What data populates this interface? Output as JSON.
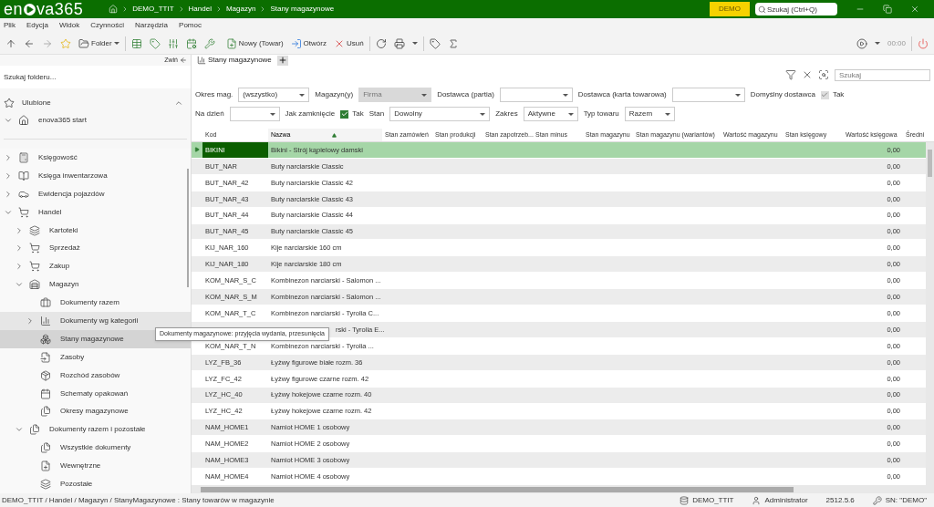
{
  "title_bar": {
    "logo_left": "en",
    "logo_right": "va365",
    "breadcrumb": [
      "DEMO_TTIT",
      "Handel",
      "Magazyn",
      "Stany magazynowe"
    ],
    "badge": "DEMO",
    "search": {
      "placeholder": "Szukaj (Ctrl+Q)"
    }
  },
  "menu": [
    "Plik",
    "Edycja",
    "Widok",
    "Czynności",
    "Narzędzia",
    "Pomoc"
  ],
  "toolbar": {
    "folder": "Folder",
    "new": "Nowy (Towar)",
    "open": "Otwórz",
    "delete": "Usuń",
    "timer": "00:00"
  },
  "sidebar": {
    "collapse": "Zwiń",
    "search": {
      "placeholder": "Szukaj folderu..."
    },
    "favorites": "Ulubione",
    "start": {
      "label": "enova365 start",
      "expanded": true
    },
    "items": [
      {
        "label": "Księgowość",
        "expanded": false,
        "selected": false
      },
      {
        "label": "Księga inwentarzowa",
        "expanded": false,
        "selected": false
      },
      {
        "label": "Ewidencja pojazdów",
        "expanded": false,
        "selected": false
      },
      {
        "label": "Handel",
        "expanded": true,
        "selected": false,
        "children": [
          {
            "label": "Kartoteki",
            "expanded": false,
            "selected": false
          },
          {
            "label": "Sprzedaż",
            "expanded": false,
            "selected": false
          },
          {
            "label": "Zakup",
            "expanded": false,
            "selected": false
          },
          {
            "label": "Magazyn",
            "expanded": true,
            "selected": false,
            "children": [
              {
                "label": "Dokumenty razem",
                "selected": false
              },
              {
                "label": "Dokumenty wg kategorii",
                "expanded": false,
                "selected": false,
                "hovered": true
              },
              {
                "label": "Stany magazynowe",
                "selected": true
              },
              {
                "label": "Zasoby",
                "selected": false
              },
              {
                "label": "Rozchód zasobów",
                "selected": false
              },
              {
                "label": "Schematy opakowań",
                "selected": false
              },
              {
                "label": "Okresy magazynowe",
                "selected": false
              }
            ]
          },
          {
            "label": "Dokumenty razem i pozostałe",
            "expanded": true,
            "selected": false,
            "children": [
              {
                "label": "Wszystkie dokumenty",
                "selected": false
              },
              {
                "label": "Wewnętrzne",
                "selected": false
              },
              {
                "label": "Pozostałe",
                "selected": false
              }
            ]
          }
        ]
      }
    ]
  },
  "tooltip": "Dokumenty magazynowe: przyjęcia wydania, przesunięcia",
  "tab": {
    "label": "Stany magazynowe",
    "selected": true
  },
  "grid_search": {
    "placeholder": "Szukaj"
  },
  "filters": [
    [
      {
        "kind": "label",
        "text": "Okres mag."
      },
      {
        "kind": "select",
        "value": "(wszystko)",
        "disabled": false
      },
      {
        "kind": "label",
        "text": "Magazyn(y)"
      },
      {
        "kind": "select",
        "value": "Firma",
        "disabled": true
      },
      {
        "kind": "label",
        "text": "Dostawca (partia)"
      },
      {
        "kind": "select",
        "disabled": false
      },
      {
        "kind": "label",
        "text": "Dostawca (karta towarowa)"
      },
      {
        "kind": "select",
        "disabled": false
      },
      {
        "kind": "label",
        "text": "Domyślny dostawca"
      },
      {
        "kind": "checkbox",
        "text": "Tak",
        "checked": true,
        "disabled": true
      }
    ],
    [
      {
        "kind": "label",
        "text": "Na dzień"
      },
      {
        "kind": "select",
        "disabled": false
      },
      {
        "kind": "label",
        "text": "Jak zamknięcie"
      },
      {
        "kind": "checkbox",
        "text": "Tak",
        "checked": true,
        "disabled": false
      },
      {
        "kind": "label",
        "text": "Stan"
      },
      {
        "kind": "select",
        "value": "Dowolny",
        "disabled": false
      },
      {
        "kind": "label",
        "text": "Zakres"
      },
      {
        "kind": "select",
        "value": "Aktywne",
        "disabled": false
      },
      {
        "kind": "label",
        "text": "Typ towaru"
      },
      {
        "kind": "select",
        "value": "Razem",
        "disabled": false
      }
    ]
  ],
  "table": {
    "columns": [
      {
        "label": "Kod",
        "sorted": false
      },
      {
        "label": "Nazwa",
        "sorted": true
      },
      {
        "label": "Stan zamówień",
        "sorted": false
      },
      {
        "label": "Stan produkcji",
        "sorted": false
      },
      {
        "label": "Stan zapotrzeb...",
        "sorted": false
      },
      {
        "label": "Stan minus",
        "sorted": false
      },
      {
        "label": "Stan magazynu",
        "sorted": false
      },
      {
        "label": "Stan magazynu (wariantów)",
        "sorted": false
      },
      {
        "label": "Wartość magazynu",
        "sorted": false
      },
      {
        "label": "Stan księgowy",
        "sorted": false
      },
      {
        "label": "Wartość księgowa",
        "sorted": false
      },
      {
        "label": "Średni",
        "sorted": false
      }
    ],
    "rows": [
      {
        "code": "BIKINI",
        "name": "Bikini - Strój kąpielowy damski",
        "value": "0,00",
        "selected": true
      },
      {
        "code": "BUT_NAR",
        "name": "Buty narciarskie Classic",
        "value": "0,00",
        "selected": false
      },
      {
        "code": "BUT_NAR_42",
        "name": "Buty narciarskie Classic 42",
        "value": "0,00",
        "selected": false
      },
      {
        "code": "BUT_NAR_43",
        "name": "Buty narciarskie Classic 43",
        "value": "0,00",
        "selected": false
      },
      {
        "code": "BUT_NAR_44",
        "name": "Buty narciarskie Classic 44",
        "value": "0,00",
        "selected": false
      },
      {
        "code": "BUT_NAR_45",
        "name": "Buty narciarskie Classic 45",
        "value": "0,00",
        "selected": false
      },
      {
        "code": "KIJ_NAR_160",
        "name": "Kije narciarskie 160 cm",
        "value": "0,00",
        "selected": false
      },
      {
        "code": "KIJ_NAR_180",
        "name": "Kije narciarskie 180 cm",
        "value": "0,00",
        "selected": false
      },
      {
        "code": "KOM_NAR_S_C",
        "name": "Kombinezon narciarski - Salomon ...",
        "value": "0,00",
        "selected": false
      },
      {
        "code": "KOM_NAR_S_M",
        "name": "Kombinezon narciarski - Salomon ...",
        "value": "0,00",
        "selected": false
      },
      {
        "code": "KOM_NAR_T_C",
        "name": "Kombinezon narciarski - Tyrolia C...",
        "value": "0,00",
        "selected": false
      },
      {
        "name": "rski - Tyrolia E...",
        "value": "0,00",
        "selected": false
      },
      {
        "code": "KOM_NAR_T_N",
        "name": "Kombinezon narciarski - Tyrolia ...",
        "value": "0,00",
        "selected": false
      },
      {
        "code": "LYZ_FB_36",
        "name": "Łyżwy figurowe białe rozm. 36",
        "value": "0,00",
        "selected": false
      },
      {
        "code": "LYZ_FC_42",
        "name": "Łyżwy figurowe czarne rozm. 42",
        "value": "0,00",
        "selected": false
      },
      {
        "code": "LYZ_HC_40",
        "name": "Łyżwy hokejowe czarne rozm. 40",
        "value": "0,00",
        "selected": false
      },
      {
        "code": "LYZ_HC_42",
        "name": "Łyżwy hokejowe czarne rozm. 42",
        "value": "0,00",
        "selected": false
      },
      {
        "code": "NAM_HOME1",
        "name": "Namiot HOME 1 osobowy",
        "value": "0,00",
        "selected": false
      },
      {
        "code": "NAM_HOME2",
        "name": "Namiot HOME 2 osobowy",
        "value": "0,00",
        "selected": false
      },
      {
        "code": "NAM_HOME3",
        "name": "Namiot HOME 3 osobowy",
        "value": "0,00",
        "selected": false
      },
      {
        "code": "NAM_HOME4",
        "name": "Namiot HOME 4 osobowy",
        "value": "0,00",
        "selected": false
      }
    ]
  },
  "status_bar": {
    "path": "DEMO_TTIT / Handel / Magazyn / StanyMagazynowe : Stany towarów w magazynie",
    "database": "DEMO_TTIT",
    "user": "Administrator",
    "version": "2512.5.6",
    "serial": "SN: \"DEMO\""
  }
}
